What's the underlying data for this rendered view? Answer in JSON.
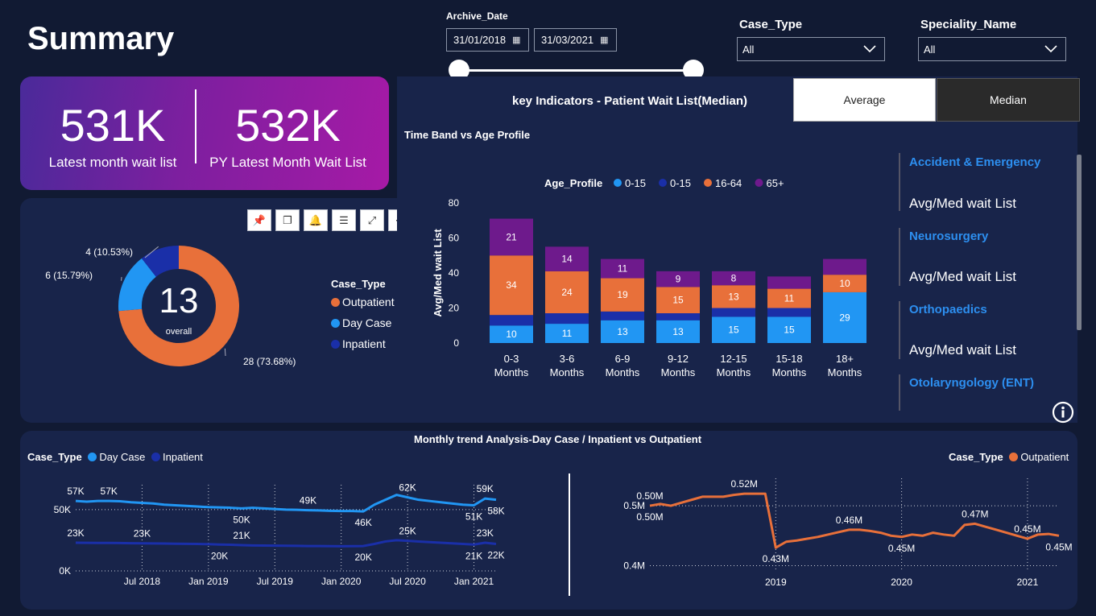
{
  "page": {
    "title": "Summary"
  },
  "filters": {
    "archive_date": {
      "label": "Archive_Date",
      "start": "31/01/2018",
      "end": "31/03/2021"
    },
    "case_type": {
      "label": "Case_Type",
      "value": "All"
    },
    "speciality": {
      "label": "Speciality_Name",
      "value": "All"
    }
  },
  "kpis": [
    {
      "value": "531K",
      "label": "Latest month wait list"
    },
    {
      "value": "532K",
      "label": "PY Latest Month Wait List"
    }
  ],
  "donut": {
    "center_value": "13",
    "center_label": "overall",
    "legend_title": "Case_Type",
    "slices": [
      {
        "name": "Outpatient",
        "value": 28,
        "label": "28 (73.68%)",
        "color": "#e8703a"
      },
      {
        "name": "Day Case",
        "value": 6,
        "label": "6 (15.79%)",
        "color": "#2196f3"
      },
      {
        "name": "Inpatient",
        "value": 4,
        "label": "4 (10.53%)",
        "color": "#1a2fa8"
      }
    ]
  },
  "toolbar": {
    "icons": [
      "pin-icon",
      "copy-icon",
      "bell-icon",
      "filter-icon",
      "expand-icon",
      "more-icon"
    ]
  },
  "key_indicators": {
    "title": "key Indicators - Patient Wait List(Median)",
    "tabs": [
      "Average",
      "Median"
    ],
    "subtitle": "Time Band vs Age Profile"
  },
  "sidebar": {
    "items": [
      {
        "name": "Accident & Emergency",
        "metric": "Avg/Med wait List"
      },
      {
        "name": "Neurosurgery",
        "metric": "Avg/Med wait List"
      },
      {
        "name": "Orthopaedics",
        "metric": "Avg/Med wait List"
      },
      {
        "name": "Otolaryngology (ENT)",
        "metric": ""
      }
    ]
  },
  "bottom": {
    "title": "Monthly trend Analysis-Day Case / Inpatient vs Outpatient",
    "left_legend_title": "Case_Type",
    "left_legend": [
      "Day Case",
      "Inpatient"
    ],
    "right_legend_title": "Case_Type",
    "right_legend": [
      "Outpatient"
    ]
  },
  "chart_data": [
    {
      "type": "bar",
      "stacked": true,
      "title": "Time Band vs Age Profile",
      "ylabel": "Avg/Med wait List",
      "ylim": [
        0,
        80
      ],
      "yticks": [
        0,
        20,
        40,
        60,
        80
      ],
      "legend_title": "Age_Profile",
      "categories": [
        [
          "0-3",
          "Months"
        ],
        [
          "3-6",
          "Months"
        ],
        [
          "6-9",
          "Months"
        ],
        [
          "9-12",
          "Months"
        ],
        [
          "12-15",
          "Months"
        ],
        [
          "15-18",
          "Months"
        ],
        [
          "18+",
          "Months"
        ]
      ],
      "series": [
        {
          "name": "0-15",
          "color": "#2196f3",
          "values": [
            10,
            11,
            13,
            13,
            15,
            15,
            29
          ]
        },
        {
          "name": "0-15",
          "color": "#1a2fa8",
          "values": [
            6,
            6,
            5,
            4,
            5,
            5,
            0
          ]
        },
        {
          "name": "16-64",
          "color": "#e8703a",
          "values": [
            34,
            24,
            19,
            15,
            13,
            11,
            10
          ]
        },
        {
          "name": "65+",
          "color": "#6e1a8c",
          "values": [
            21,
            14,
            11,
            9,
            8,
            7,
            9
          ]
        }
      ],
      "data_labels": [
        {
          "series": 0,
          "show": [
            true,
            true,
            true,
            true,
            true,
            true,
            true
          ]
        },
        {
          "series": 1,
          "show": [
            false,
            false,
            false,
            false,
            false,
            false,
            false
          ]
        },
        {
          "series": 2,
          "show": [
            true,
            true,
            true,
            true,
            true,
            true,
            true
          ]
        },
        {
          "series": 3,
          "show": [
            true,
            true,
            true,
            true,
            true,
            false,
            false
          ]
        }
      ]
    },
    {
      "type": "line",
      "ylim": [
        0,
        65000
      ],
      "ytick_labels": [
        {
          "v": 50000,
          "t": "50K"
        },
        {
          "v": 0,
          "t": "0K"
        }
      ],
      "xtick_labels": [
        {
          "x": 6,
          "t": "Jul 2018"
        },
        {
          "x": 12,
          "t": "Jan 2019"
        },
        {
          "x": 18,
          "t": "Jul 2019"
        },
        {
          "x": 24,
          "t": "Jan 2020"
        },
        {
          "x": 30,
          "t": "Jul 2020"
        },
        {
          "x": 36,
          "t": "Jan 2021"
        }
      ],
      "x_count": 39,
      "series": [
        {
          "name": "Day Case",
          "color": "#2196f3",
          "values": [
            57000,
            56500,
            57000,
            57000,
            56800,
            56000,
            55500,
            55000,
            54000,
            53500,
            53000,
            52500,
            52000,
            51800,
            51500,
            51000,
            51500,
            51000,
            50500,
            50000,
            49800,
            49500,
            49300,
            49000,
            48800,
            48800,
            48500,
            54000,
            58000,
            62000,
            60000,
            58000,
            57000,
            56000,
            55000,
            54000,
            53500,
            59000,
            58000
          ],
          "labels": [
            {
              "i": 0,
              "t": "57K",
              "pos": "above"
            },
            {
              "i": 3,
              "t": "57K",
              "pos": "above"
            },
            {
              "i": 15,
              "t": "50K",
              "pos": "below"
            },
            {
              "i": 21,
              "t": "49K",
              "pos": "above"
            },
            {
              "i": 26,
              "t": "46K",
              "pos": "below"
            },
            {
              "i": 30,
              "t": "62K",
              "pos": "above"
            },
            {
              "i": 36,
              "t": "51K",
              "pos": "below"
            },
            {
              "i": 37,
              "t": "59K",
              "pos": "above"
            },
            {
              "i": 38,
              "t": "58K",
              "pos": "below"
            }
          ]
        },
        {
          "name": "Inpatient",
          "color": "#1a2fa8",
          "values": [
            23000,
            22900,
            22800,
            22800,
            22700,
            22600,
            22500,
            22400,
            22300,
            22200,
            22100,
            22000,
            21800,
            21500,
            21300,
            21000,
            20800,
            20700,
            20600,
            20500,
            20400,
            20300,
            20300,
            20200,
            20100,
            20200,
            20300,
            22000,
            24000,
            25000,
            24500,
            24000,
            23500,
            23000,
            22500,
            22000,
            21500,
            23000,
            22000
          ],
          "labels": [
            {
              "i": 0,
              "t": "23K",
              "pos": "above"
            },
            {
              "i": 6,
              "t": "23K",
              "pos": "above"
            },
            {
              "i": 15,
              "t": "21K",
              "pos": "above"
            },
            {
              "i": 13,
              "t": "20K",
              "pos": "below"
            },
            {
              "i": 26,
              "t": "20K",
              "pos": "below"
            },
            {
              "i": 30,
              "t": "25K",
              "pos": "above"
            },
            {
              "i": 36,
              "t": "21K",
              "pos": "below"
            },
            {
              "i": 37,
              "t": "23K",
              "pos": "above"
            },
            {
              "i": 38,
              "t": "22K",
              "pos": "below"
            }
          ]
        }
      ]
    },
    {
      "type": "line",
      "ylim": [
        0.39,
        0.535
      ],
      "ytick_labels": [
        {
          "v": 0.5,
          "t": "0.5M"
        },
        {
          "v": 0.4,
          "t": "0.4M"
        }
      ],
      "xtick_labels": [
        {
          "x": 12,
          "t": "2019"
        },
        {
          "x": 24,
          "t": "2020"
        },
        {
          "x": 36,
          "t": "2021"
        }
      ],
      "x_count": 40,
      "series": [
        {
          "name": "Outpatient",
          "color": "#e8703a",
          "values": [
            0.5,
            0.503,
            0.5,
            0.505,
            0.51,
            0.515,
            0.515,
            0.515,
            0.518,
            0.52,
            0.52,
            0.52,
            0.43,
            0.44,
            0.442,
            0.445,
            0.448,
            0.452,
            0.456,
            0.46,
            0.46,
            0.458,
            0.455,
            0.45,
            0.448,
            0.452,
            0.45,
            0.455,
            0.452,
            0.45,
            0.468,
            0.47,
            0.465,
            0.46,
            0.455,
            0.45,
            0.445,
            0.452,
            0.453,
            0.45
          ],
          "labels": [
            {
              "i": 0,
              "t": "0.50M",
              "pos": "above"
            },
            {
              "i": 0,
              "t": "0.50M",
              "pos": "below"
            },
            {
              "i": 9,
              "t": "0.52M",
              "pos": "above"
            },
            {
              "i": 12,
              "t": "0.43M",
              "pos": "below"
            },
            {
              "i": 19,
              "t": "0.46M",
              "pos": "above"
            },
            {
              "i": 24,
              "t": "0.45M",
              "pos": "below"
            },
            {
              "i": 31,
              "t": "0.47M",
              "pos": "above"
            },
            {
              "i": 36,
              "t": "0.45M",
              "pos": "above"
            },
            {
              "i": 39,
              "t": "0.45M",
              "pos": "below"
            }
          ]
        }
      ]
    }
  ]
}
